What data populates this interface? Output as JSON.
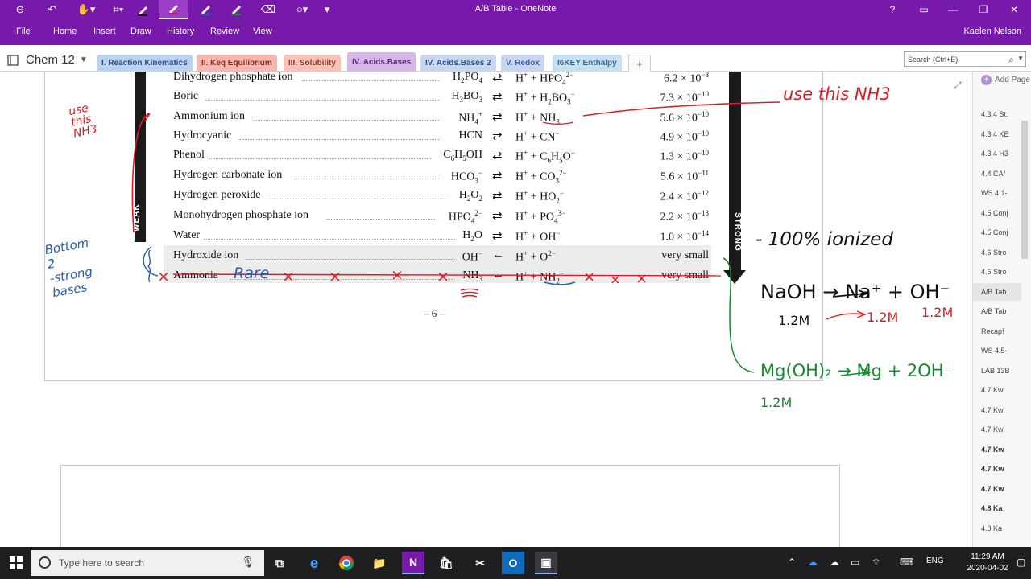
{
  "window": {
    "title": "A/B Table - OneNote",
    "help": "?",
    "user": "Kaelen Nelson"
  },
  "ribbon": {
    "menus": [
      "File",
      "Home",
      "Insert",
      "Draw",
      "History",
      "Review",
      "View"
    ]
  },
  "notebook": {
    "name": "Chem 12",
    "sections": [
      {
        "label": "I. Reaction Kinematics",
        "color": "#bcd3ef",
        "text_color": "#2b4f86"
      },
      {
        "label": "II. Keq Equilibrium",
        "color": "#f6b7b0",
        "text_color": "#8a2c24"
      },
      {
        "label": "III. Solubility",
        "color": "#f7c2b8",
        "text_color": "#8a3f30"
      },
      {
        "label": "IV. Acids.Bases",
        "color": "#d7b6e9",
        "text_color": "#5a2a78"
      },
      {
        "label": "IV. Acids.Bases 2",
        "color": "#c9d7ee",
        "text_color": "#2b4f86"
      },
      {
        "label": "V. Redox",
        "color": "#c9d6f2",
        "text_color": "#3e5f9c"
      },
      {
        "label": "I6KEY Enthalpy",
        "color": "#c8e0f2",
        "text_color": "#3b6a8d"
      }
    ],
    "add_tab": "+",
    "search_placeholder": "Search (Ctrl+E)"
  },
  "table": {
    "rows": [
      {
        "name": "Dihydrogen phosphate ion",
        "acid": "H<sub>2</sub>PO<sub>4</sub>",
        "arrow": "⇄",
        "products": "H<sup>+</sup> + HPO<sub>4</sub><sup>2−</sup>",
        "ka": "6.2 × 10<sup>−8</sup>"
      },
      {
        "name": "Boric",
        "acid": "H<sub>3</sub>BO<sub>3</sub>",
        "arrow": "⇄",
        "products": "H<sup>+</sup> + H<sub>2</sub>BO<sub>3</sub><sup>−</sup>",
        "ka": "7.3 × 10<sup>−10</sup>"
      },
      {
        "name": "Ammonium ion",
        "acid": "NH<sub>4</sub><sup>+</sup>",
        "arrow": "⇄",
        "products": "H<sup>+</sup> + NH<sub>3</sub>",
        "ka": "5.6 × 10<sup>−10</sup>"
      },
      {
        "name": "Hydrocyanic",
        "acid": "HCN",
        "arrow": "⇄",
        "products": "H<sup>+</sup> + CN<sup>−</sup>",
        "ka": "4.9 × 10<sup>−10</sup>"
      },
      {
        "name": "Phenol",
        "acid": "C<sub>6</sub>H<sub>5</sub>OH",
        "arrow": "⇄",
        "products": "H<sup>+</sup> + C<sub>6</sub>H<sub>5</sub>O<sup>−</sup>",
        "ka": "1.3 × 10<sup>−10</sup>"
      },
      {
        "name": "Hydrogen carbonate ion",
        "acid": "HCO<sub>3</sub><sup>−</sup>",
        "arrow": "⇄",
        "products": "H<sup>+</sup> + CO<sub>3</sub><sup>2−</sup>",
        "ka": "5.6 × 10<sup>−11</sup>"
      },
      {
        "name": "Hydrogen peroxide",
        "acid": "H<sub>2</sub>O<sub>2</sub>",
        "arrow": "⇄",
        "products": "H<sup>+</sup> + HO<sub>2</sub><sup>−</sup>",
        "ka": "2.4 × 10<sup>−12</sup>"
      },
      {
        "name": "Monohydrogen phosphate ion",
        "acid": "HPO<sub>4</sub><sup>2−</sup>",
        "arrow": "⇄",
        "products": "H<sup>+</sup> + PO<sub>4</sub><sup>3−</sup>",
        "ka": "2.2 × 10<sup>−13</sup>"
      },
      {
        "name": "Water",
        "acid": "H<sub>2</sub>O",
        "arrow": "⇄",
        "products": "H<sup>+</sup> + OH<sup>−</sup>",
        "ka": "1.0 × 10<sup>−14</sup>"
      },
      {
        "name": "Hydroxide ion",
        "acid": "OH<sup>−</sup>",
        "arrow": "←",
        "products": "H<sup>+</sup> + O<sup>2−</sup>",
        "ka": "very small"
      },
      {
        "name": "Ammonia",
        "acid": "NH<sub>3</sub>",
        "arrow": "←",
        "products": "H<sup>+</sup> + NH<sub>2</sub><sup>−</sup>",
        "ka": "very small"
      }
    ],
    "weak_label": "WEAK",
    "strong_label": "STRONG",
    "page_number": "– 6 –"
  },
  "ink": {
    "use_this_nh3_left": "use\nthis\nNH3",
    "use_this_nh3_right": "use  this NH3",
    "rare": "Rare",
    "cross": "×",
    "bottom_note": "Bottom\n2\n-strong\nbases",
    "ionized": "- 100%  ionized",
    "naoh_eq": "NaOH  →  Na⁺ + OH⁻",
    "conc_naoh": "1.2M",
    "conc_na": "1.2M",
    "conc_oh": "1.2M",
    "mgoh_eq": "Mg(OH)₂  →  Mg + 2OH⁻",
    "conc_mgoh": "1.2M"
  },
  "pages": {
    "add_page": "Add Page",
    "items": [
      {
        "label": "4.3.4 St.",
        "bold": false
      },
      {
        "label": "4.3.4 KE",
        "bold": false
      },
      {
        "label": "4.3.4 H3",
        "bold": false
      },
      {
        "label": "4.4 CA/",
        "bold": false
      },
      {
        "label": "WS 4.1-",
        "bold": false
      },
      {
        "label": "4.5 Conj",
        "bold": false
      },
      {
        "label": "4.5 Conj",
        "bold": false
      },
      {
        "label": "4.6 Stro",
        "bold": false
      },
      {
        "label": "4.6 Stro",
        "bold": false
      },
      {
        "label": "A/B Tab",
        "bold": false,
        "selected": true
      },
      {
        "label": "A/B Tab",
        "bold": false
      },
      {
        "label": "Recap!",
        "bold": false
      },
      {
        "label": "WS 4.5-",
        "bold": false
      },
      {
        "label": "LAB 13B",
        "bold": false
      },
      {
        "label": "4.7 Kw",
        "bold": false
      },
      {
        "label": "4.7 Kw",
        "bold": false
      },
      {
        "label": "4.7 Kw",
        "bold": false
      },
      {
        "label": "4.7 Kw",
        "bold": true
      },
      {
        "label": "4.7 Kw",
        "bold": true
      },
      {
        "label": "4.7 Kw",
        "bold": true
      },
      {
        "label": "4.8 Ka",
        "bold": true
      },
      {
        "label": "4.8 Ka",
        "bold": false
      }
    ]
  },
  "taskbar": {
    "search_placeholder": "Type here to search",
    "lang": "ENG",
    "time": "11:29 AM",
    "date": "2020-04-02"
  }
}
